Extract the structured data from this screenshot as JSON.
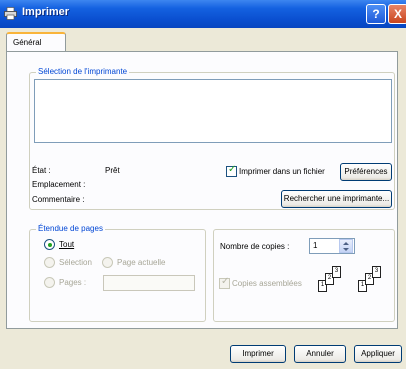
{
  "window": {
    "title": "Imprimer",
    "help_glyph": "?",
    "close_glyph": "X"
  },
  "tabs": [
    {
      "label": "Général"
    }
  ],
  "printer_selection": {
    "title": "Sélection de l'imprimante",
    "status_label": "État :",
    "status_value": "Prêt",
    "location_label": "Emplacement :",
    "comment_label": "Commentaire :",
    "print_to_file": {
      "label": "Imprimer dans un fichier",
      "checked": true
    },
    "preferences_button": "Préférences",
    "find_printer_button": "Rechercher une imprimante..."
  },
  "page_range": {
    "title": "Étendue de pages",
    "all": "Tout",
    "selection": "Sélection",
    "current_page": "Page actuelle",
    "pages": "Pages :",
    "pages_value": ""
  },
  "copies": {
    "number_label": "Nombre de copies :",
    "number_value": "1",
    "collate": {
      "label": "Copies assemblées",
      "checked": true,
      "enabled": false
    },
    "collate_preview": [
      "1",
      "2",
      "3",
      "1",
      "2",
      "3"
    ]
  },
  "footer": {
    "print_button": "Imprimer",
    "cancel_button": "Annuler",
    "apply_button": "Appliquer"
  },
  "colors": {
    "title_bar": "#0a4fd0",
    "group_title": "#0046d5",
    "checkmark": "#21a121",
    "tab_highlight": "#f9b43a"
  }
}
